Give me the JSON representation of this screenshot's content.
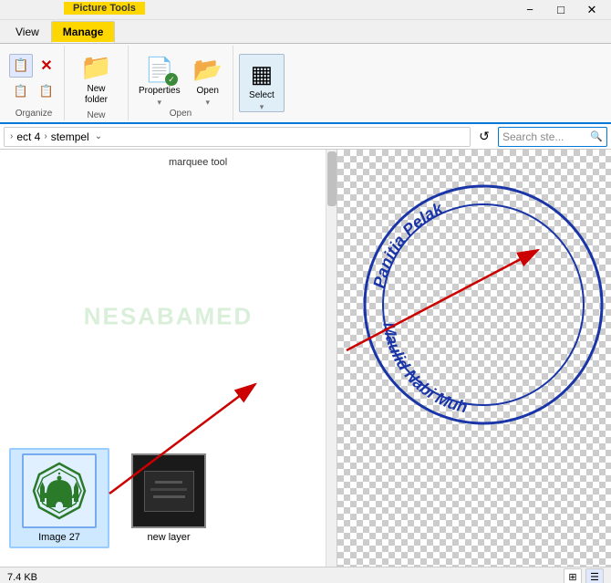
{
  "titlebar": {
    "min_btn": "−",
    "max_btn": "□",
    "close_btn": "✕"
  },
  "ribbon": {
    "picture_tools_label": "Picture Tools",
    "tabs": [
      "View",
      "Manage"
    ],
    "groups": {
      "organize": {
        "label": "Organize",
        "buttons": [
          {
            "icon": "⬛",
            "label": ""
          },
          {
            "icon": "✕",
            "label": ""
          },
          {
            "icon": "⬛",
            "label": ""
          },
          {
            "icon": "⬛",
            "label": ""
          }
        ]
      },
      "new": {
        "label": "New",
        "new_folder_icon": "📁",
        "new_folder_label": "New\nfolder"
      },
      "open": {
        "label": "Open",
        "properties_label": "Properties",
        "open_label": "Open"
      },
      "select": {
        "label": "",
        "select_label": "Select",
        "select_icon": "▦"
      }
    }
  },
  "address_bar": {
    "path_part1": "ect 4",
    "arrow": "›",
    "path_part2": "stempel",
    "dropdown_arrow": "⌄",
    "refresh_icon": "↺",
    "search_placeholder": "Search ste...",
    "search_icon": "🔍"
  },
  "file_panel": {
    "watermark": "NESABAMED",
    "marquee_label": "marquee tool",
    "scroll_visible": true
  },
  "files": [
    {
      "name": "Image 27",
      "type": "mosque",
      "selected": true,
      "size": "7.4 KB"
    },
    {
      "name": "new layer",
      "type": "layer",
      "selected": false
    }
  ],
  "right_panel": {
    "arrow_color": "#cc0000",
    "stamp": {
      "outer_text_top": "Panitia Pelak",
      "inner_text_bottom": "Maulid Nabi Muh",
      "color": "#1a35a8"
    }
  },
  "status_bar": {
    "size_label": "7.4 KB",
    "view_icons": [
      "grid",
      "list"
    ]
  }
}
